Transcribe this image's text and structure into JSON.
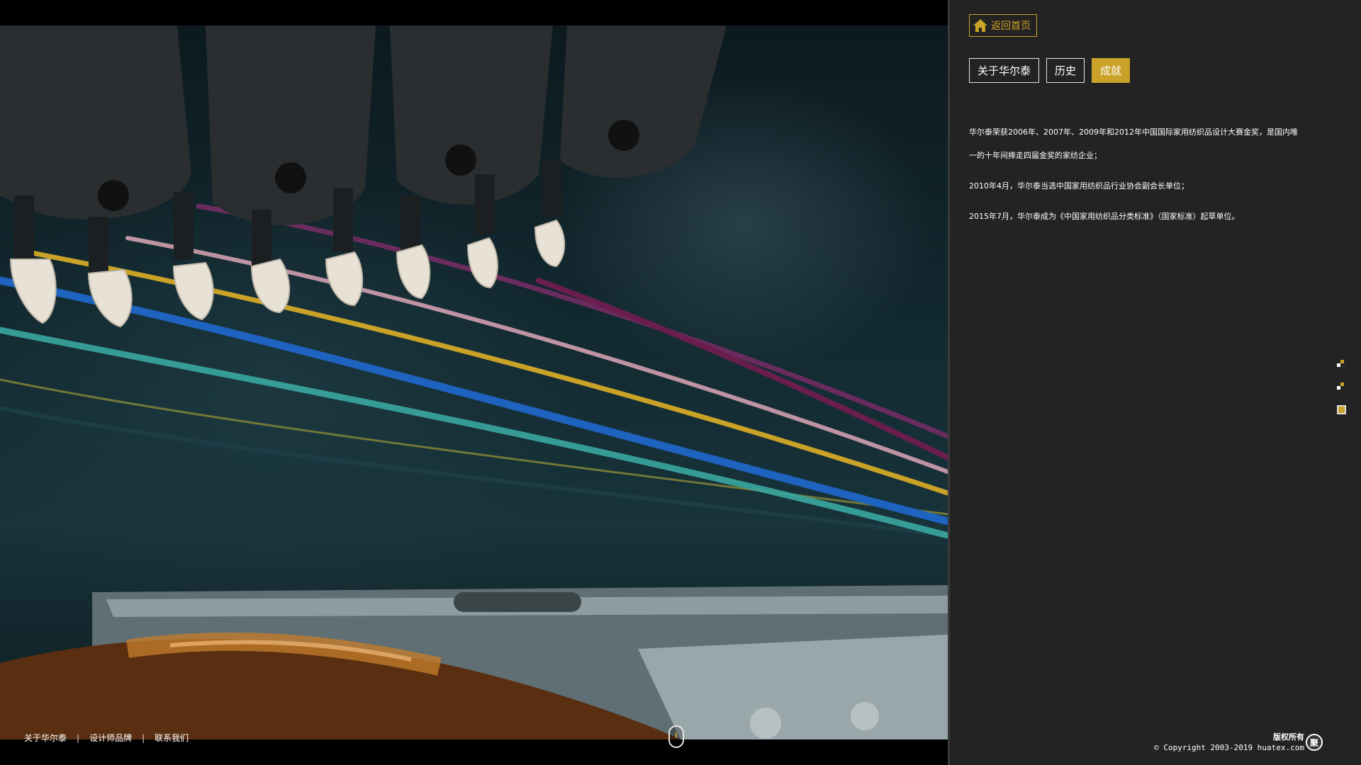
{
  "photo": {
    "alt": ""
  },
  "footer": {
    "links": [
      "关于华尔泰",
      "设计师品牌",
      "联系我们"
    ],
    "separator": "|"
  },
  "panel": {
    "home_button": {
      "label": "返回首页",
      "icon": "home-icon"
    },
    "tabs": [
      {
        "label": "关于华尔泰",
        "active": false
      },
      {
        "label": "历史",
        "active": false
      },
      {
        "label": "成就",
        "active": true
      }
    ],
    "content": {
      "paragraphs": [
        "华尔泰荣获2006年、2007年、2009年和2012年中国国际家用纺织品设计大赛金奖，是国内唯一的十年间捧走四届金奖的家纺企业；",
        "2010年4月，华尔泰当选中国家用纺织品行业协会副会长单位；",
        "2015年7月，华尔泰成为《中国家用纺织品分类标准》（国家标准）起草单位。"
      ]
    },
    "copyright": {
      "title": "版权所有",
      "line": "© Copyright 2003-2019 huatex.com",
      "stamp_text": "聚"
    }
  },
  "colors": {
    "accent": "#c9a227",
    "panel_bg": "#232323",
    "page_bg": "#000000"
  }
}
